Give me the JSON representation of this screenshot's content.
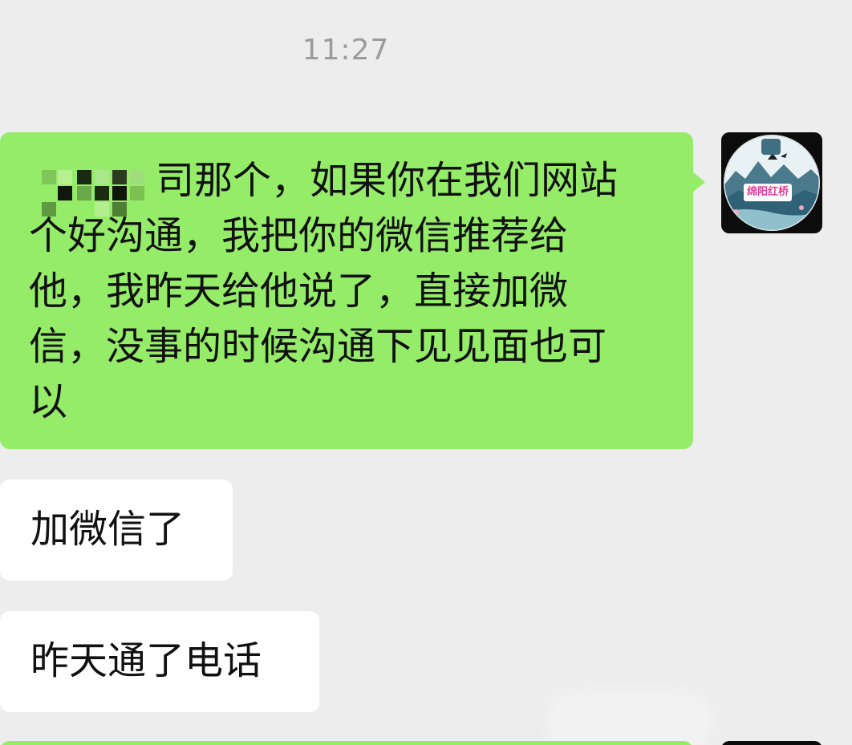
{
  "chat": {
    "timestamp": "11:27",
    "messages": [
      {
        "direction": "sent",
        "text": "司那个，如果你在我们网站\n个好沟通，我把你的微信推荐给\n他，我昨天给他说了，直接加微\n信，没事的时候沟通下见见面也可\n以",
        "redacted_prefix": true
      },
      {
        "direction": "received",
        "text": "加微信了"
      },
      {
        "direction": "received",
        "text": "昨天通了电话"
      }
    ]
  },
  "avatar": {
    "label": "绵阳红桥",
    "icon": "avatar-landscape-magpies"
  },
  "colors": {
    "background": "#ededed",
    "sent_bubble": "#95ec69",
    "received_bubble": "#ffffff",
    "timestamp": "#9c9c9c",
    "avatar_label": "#e0409a"
  }
}
